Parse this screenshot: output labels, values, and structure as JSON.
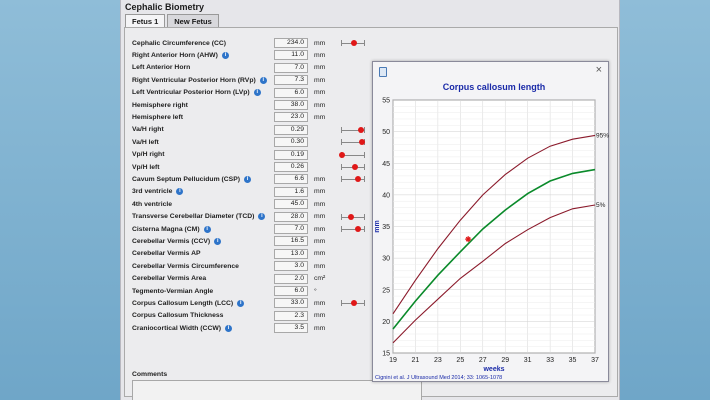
{
  "panel_title": "Cephalic Biometry",
  "tabs": [
    {
      "label": "Fetus 1",
      "active": true
    },
    {
      "label": "New Fetus",
      "active": false
    }
  ],
  "rows": [
    {
      "label": "Cephalic Circumference (CC)",
      "info": false,
      "value": "234.0",
      "unit": "mm",
      "percentile": 0.55
    },
    {
      "label": "Right Anterior Horn (AHW)",
      "info": true,
      "value": "11.0",
      "unit": "mm",
      "percentile": null
    },
    {
      "label": "Left Anterior Horn",
      "info": false,
      "value": "7.0",
      "unit": "mm",
      "percentile": null
    },
    {
      "label": "Right Ventricular Posterior Horn (RVp)",
      "info": true,
      "value": "7.3",
      "unit": "mm",
      "percentile": null
    },
    {
      "label": "Left Ventricular Posterior Horn (LVp)",
      "info": true,
      "value": "6.0",
      "unit": "mm",
      "percentile": null
    },
    {
      "label": "Hemisphere right",
      "info": false,
      "value": "38.0",
      "unit": "mm",
      "percentile": null
    },
    {
      "label": "Hemisphere left",
      "info": false,
      "value": "23.0",
      "unit": "mm",
      "percentile": null
    },
    {
      "label": "Va/H right",
      "info": false,
      "value": "0.29",
      "unit": "",
      "percentile": 0.85
    },
    {
      "label": "Va/H left",
      "info": false,
      "value": "0.30",
      "unit": "",
      "percentile": 0.88
    },
    {
      "label": "Vp/H right",
      "info": false,
      "value": "0.19",
      "unit": "",
      "percentile": 0.05
    },
    {
      "label": "Vp/H left",
      "info": false,
      "value": "0.26",
      "unit": "",
      "percentile": 0.6
    },
    {
      "label": "Cavum Septum Pellucidum (CSP)",
      "info": true,
      "value": "6.6",
      "unit": "mm",
      "percentile": 0.7
    },
    {
      "label": "3rd ventricle",
      "info": true,
      "value": "1.6",
      "unit": "mm",
      "percentile": null
    },
    {
      "label": "4th ventricle",
      "info": false,
      "value": "45.0",
      "unit": "mm",
      "percentile": null
    },
    {
      "label": "Transverse Cerebellar Diameter (TCD)",
      "info": true,
      "value": "28.0",
      "unit": "mm",
      "percentile": 0.4
    },
    {
      "label": "Cisterna Magna (CM)",
      "info": true,
      "value": "7.0",
      "unit": "mm",
      "percentile": 0.7
    },
    {
      "label": "Cerebellar Vermis (CCV)",
      "info": true,
      "value": "16.5",
      "unit": "mm",
      "percentile": null
    },
    {
      "label": "Cerebellar Vermis AP",
      "info": false,
      "value": "13.0",
      "unit": "mm",
      "percentile": null
    },
    {
      "label": "Cerebellar Vermis Circumference",
      "info": false,
      "value": "3.0",
      "unit": "mm",
      "percentile": null
    },
    {
      "label": "Cerebellar Vermis Area",
      "info": false,
      "value": "2.0",
      "unit": "cm²",
      "percentile": null
    },
    {
      "label": "Tegmento-Vermian Angle",
      "info": false,
      "value": "6.0",
      "unit": "°",
      "percentile": null
    },
    {
      "label": "Corpus Callosum Length (LCC)",
      "info": true,
      "value": "33.0",
      "unit": "mm",
      "percentile": 0.55
    },
    {
      "label": "Corpus Callosum Thickness",
      "info": false,
      "value": "2.3",
      "unit": "mm",
      "percentile": null
    },
    {
      "label": "Craniocortical Width (CCW)",
      "info": true,
      "value": "3.5",
      "unit": "mm",
      "percentile": null
    }
  ],
  "comments_label": "Comments",
  "chart_window": {
    "close_glyph": "×"
  },
  "chart_data": {
    "type": "line",
    "title": "Corpus callosum length",
    "xlabel": "weeks",
    "ylabel": "mm",
    "citation": "Cignini et al. J Ultrasound Med 2014; 33: 1065-1078",
    "xlim": [
      19,
      37
    ],
    "ylim": [
      15,
      55
    ],
    "x_ticks": [
      19,
      21,
      23,
      25,
      27,
      29,
      31,
      33,
      35,
      37
    ],
    "y_ticks": [
      15,
      20,
      25,
      30,
      35,
      40,
      45,
      50,
      55
    ],
    "series": [
      {
        "name": "95%",
        "color": "#8b1a2b",
        "x": [
          19,
          21,
          23,
          25,
          27,
          29,
          31,
          33,
          35,
          37
        ],
        "values": [
          21.2,
          26.5,
          31.5,
          36.0,
          40.0,
          43.2,
          45.8,
          47.7,
          48.8,
          49.4
        ]
      },
      {
        "name": "",
        "color": "#0a8a2a",
        "x": [
          19,
          21,
          23,
          25,
          27,
          29,
          31,
          33,
          35,
          37
        ],
        "values": [
          18.8,
          23.2,
          27.3,
          31.0,
          34.6,
          37.6,
          40.2,
          42.2,
          43.4,
          44.0
        ]
      },
      {
        "name": "5%",
        "color": "#8b1a2b",
        "x": [
          19,
          21,
          23,
          25,
          27,
          29,
          31,
          33,
          35,
          37
        ],
        "values": [
          16.6,
          20.2,
          23.5,
          26.8,
          29.5,
          32.3,
          34.5,
          36.4,
          37.8,
          38.4
        ]
      }
    ],
    "points": [
      {
        "x": 25.7,
        "y": 33.0,
        "color": "#e01818",
        "marker": "star"
      }
    ],
    "grid": true
  }
}
